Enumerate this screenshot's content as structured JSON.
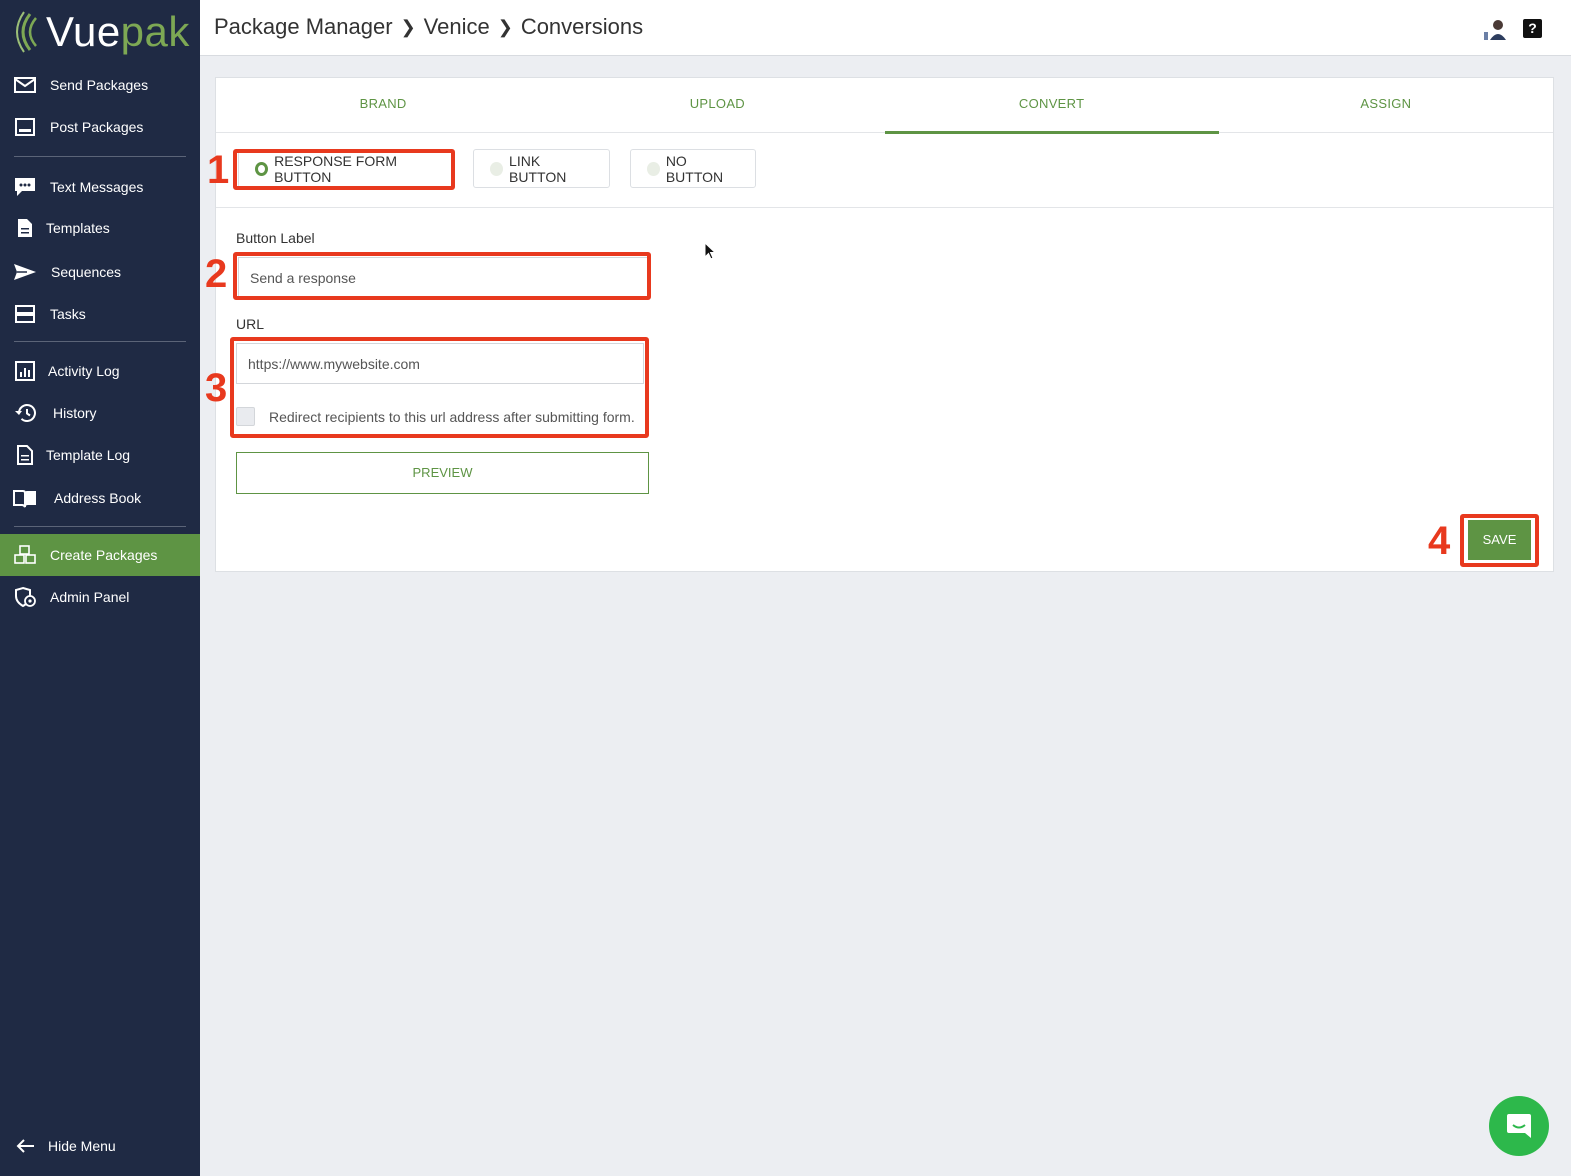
{
  "brand": {
    "logo_part1": "Vue",
    "logo_part2": "pak"
  },
  "sidebar": {
    "items": [
      {
        "label": "Send Packages",
        "icon": "envelope-icon"
      },
      {
        "label": "Post Packages",
        "icon": "monitor-icon"
      },
      {
        "label": "Text Messages",
        "icon": "chat-bubble-icon"
      },
      {
        "label": "Templates",
        "icon": "document-icon"
      },
      {
        "label": "Sequences",
        "icon": "send-arrow-icon"
      },
      {
        "label": "Tasks",
        "icon": "tasks-stack-icon"
      },
      {
        "label": "Activity Log",
        "icon": "bar-chart-icon"
      },
      {
        "label": "History",
        "icon": "history-icon"
      },
      {
        "label": "Template Log",
        "icon": "document-icon"
      },
      {
        "label": "Address Book",
        "icon": "book-icon"
      },
      {
        "label": "Create Packages",
        "icon": "boxes-icon",
        "active": true
      },
      {
        "label": "Admin Panel",
        "icon": "admin-gear-icon"
      }
    ],
    "hide_menu": "Hide Menu"
  },
  "header": {
    "breadcrumb": [
      "Package Manager",
      "Venice",
      "Conversions"
    ],
    "help_label": "?"
  },
  "tabs": [
    "BRAND",
    "UPLOAD",
    "CONVERT",
    "ASSIGN"
  ],
  "active_tab": "CONVERT",
  "button_options": [
    {
      "label": "RESPONSE FORM BUTTON",
      "selected": true
    },
    {
      "label": "LINK BUTTON",
      "selected": false
    },
    {
      "label": "NO BUTTON",
      "selected": false
    }
  ],
  "form": {
    "button_label_title": "Button Label",
    "button_label_value": "Send a response",
    "url_title": "URL",
    "url_value": "https://www.mywebsite.com",
    "redirect_text": "Redirect recipients to this url address after submitting form.",
    "redirect_checked": false,
    "preview_label": "PREVIEW",
    "save_label": "SAVE"
  },
  "annotations": [
    "1",
    "2",
    "3",
    "4"
  ],
  "colors": {
    "accent": "#5e9444",
    "sidebar": "#1f2a44",
    "annotation": "#e8391e",
    "chat": "#2db84b"
  }
}
